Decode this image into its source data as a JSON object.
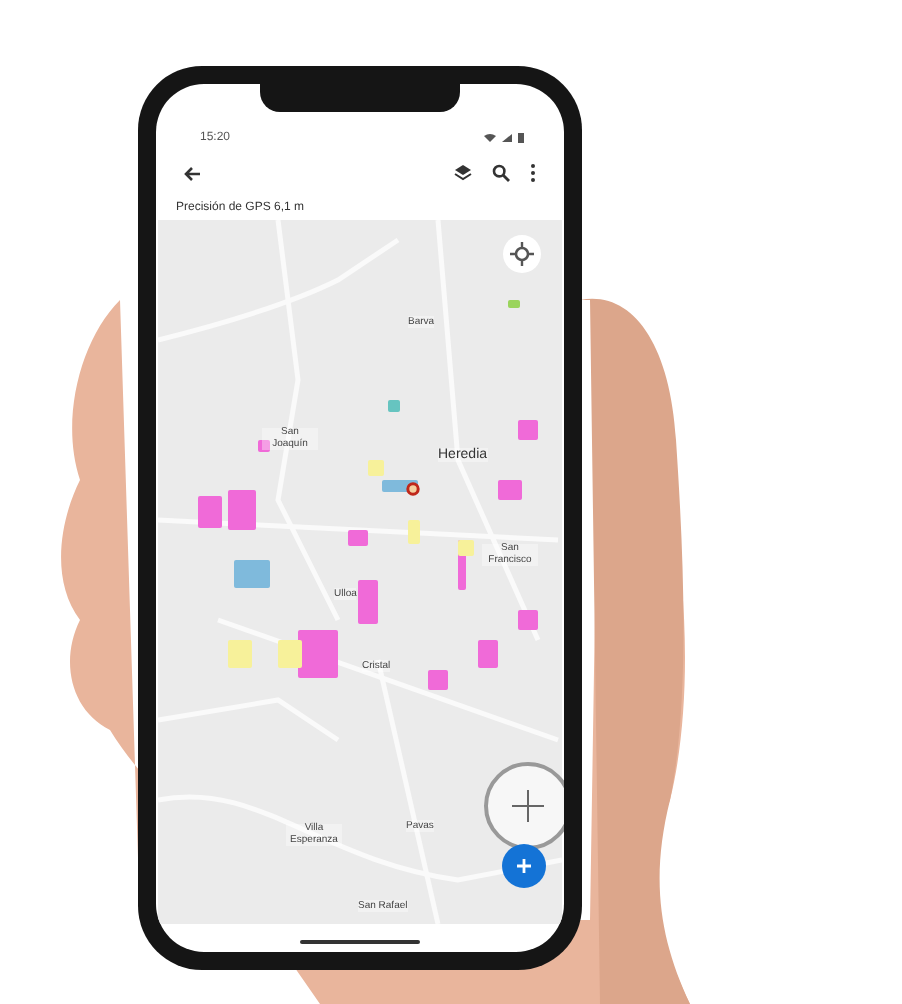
{
  "status_bar": {
    "time": "15:20"
  },
  "gps_banner": {
    "text": "Precisión de GPS 6,1 m"
  },
  "map": {
    "labels": [
      {
        "text": "Barva"
      },
      {
        "text": "San Joaquín"
      },
      {
        "text": "Heredia"
      },
      {
        "text": "San Francisco"
      },
      {
        "text": "Ulloa"
      },
      {
        "text": "Cristal"
      },
      {
        "text": "Villa Esperanza"
      },
      {
        "text": "Pavas"
      },
      {
        "text": "San Rafael"
      }
    ]
  }
}
